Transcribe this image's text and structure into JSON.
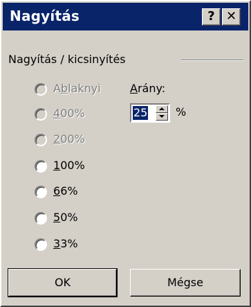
{
  "window": {
    "title": "Nagyítás",
    "help_label": "?",
    "close_label": "✕"
  },
  "group": {
    "label": "Nagyítás / kicsinyítés"
  },
  "options": [
    {
      "pre": "A",
      "u": "b",
      "post": "lakny",
      "dim": "i",
      "enabled": false,
      "selected": false
    },
    {
      "pre": "",
      "u": "4",
      "post": "00%",
      "enabled": false,
      "selected": false
    },
    {
      "pre": "",
      "u": "2",
      "post": "00%",
      "enabled": false,
      "selected": false
    },
    {
      "pre": "",
      "u": "1",
      "post": "00%",
      "enabled": true,
      "selected": false
    },
    {
      "pre": "",
      "u": "6",
      "post": "6%",
      "enabled": true,
      "selected": false
    },
    {
      "pre": "",
      "u": "5",
      "post": "0%",
      "enabled": true,
      "selected": false
    },
    {
      "pre": "",
      "u": "3",
      "post": "3%",
      "enabled": true,
      "selected": false
    }
  ],
  "ratio": {
    "label_u": "A",
    "label_rest": "rány:",
    "value": "25",
    "unit": "%"
  },
  "buttons": {
    "ok": "OK",
    "cancel": "Mégse"
  },
  "icons": {
    "up": "spin-up-arrow-icon",
    "down": "spin-down-arrow-icon"
  }
}
